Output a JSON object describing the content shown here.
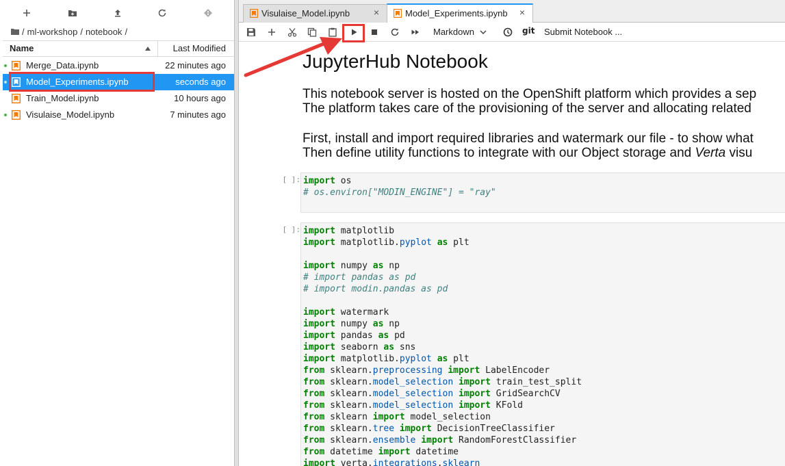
{
  "left_panel": {
    "toolbar": {
      "new_launcher": "new-launcher",
      "new_folder": "new-folder",
      "upload": "upload",
      "refresh": "refresh",
      "git_clone": "git-clone"
    },
    "breadcrumb": {
      "root_icon": "folder-icon",
      "separator": "/",
      "segments": [
        "ml-workshop",
        "notebook"
      ],
      "trailing": "/"
    },
    "file_list": {
      "headers": {
        "name": "Name",
        "modified": "Last Modified"
      },
      "files": [
        {
          "name": "Merge_Data.ipynb",
          "modified": "22 minutes ago",
          "running": true,
          "selected": false
        },
        {
          "name": "Model_Experiments.ipynb",
          "modified": "seconds ago",
          "running": true,
          "selected": true
        },
        {
          "name": "Train_Model.ipynb",
          "modified": "10 hours ago",
          "running": false,
          "selected": false
        },
        {
          "name": "Visulaise_Model.ipynb",
          "modified": "7 minutes ago",
          "running": true,
          "selected": false
        }
      ]
    }
  },
  "tabs": [
    {
      "label": "Visulaise_Model.ipynb",
      "active": false,
      "close": "×"
    },
    {
      "label": "Model_Experiments.ipynb",
      "active": true,
      "close": "×"
    }
  ],
  "notebook_toolbar": {
    "cell_type": "Markdown",
    "git_label": "git",
    "submit_label": "Submit Notebook ..."
  },
  "notebook": {
    "title": "JupyterHub Notebook",
    "para1_line1": "This notebook server is hosted on the OpenShift platform which provides a sep",
    "para1_line2": "The platform takes care of the provisioning of the server and allocating related",
    "para2_line1": "First, install and import required libraries and watermark our file - to show what",
    "para2_line2_prefix": "Then define utility functions to integrate with our Object storage and ",
    "para2_line2_em": "Verta",
    "para2_line2_suffix": " visu",
    "cells": [
      {
        "prompt": "[ ]:",
        "lines": [
          [
            [
              "kw",
              "import"
            ],
            [
              "t",
              " os"
            ]
          ],
          [
            [
              "cm",
              "# os.environ[\"MODIN_ENGINE\"] = \"ray\""
            ]
          ],
          [
            [
              "t",
              ""
            ]
          ]
        ]
      },
      {
        "prompt": "[ ]:",
        "lines": [
          [
            [
              "kw",
              "import"
            ],
            [
              "t",
              " matplotlib"
            ]
          ],
          [
            [
              "kw",
              "import"
            ],
            [
              "t",
              " matplotlib."
            ],
            [
              "attr",
              "pyplot"
            ],
            [
              "t",
              " "
            ],
            [
              "kw",
              "as"
            ],
            [
              "t",
              " plt"
            ]
          ],
          [
            [
              "t",
              ""
            ]
          ],
          [
            [
              "kw",
              "import"
            ],
            [
              "t",
              " numpy "
            ],
            [
              "kw",
              "as"
            ],
            [
              "t",
              " np"
            ]
          ],
          [
            [
              "cm",
              "# import pandas as pd"
            ]
          ],
          [
            [
              "cm",
              "# import modin.pandas as pd"
            ]
          ],
          [
            [
              "t",
              ""
            ]
          ],
          [
            [
              "kw",
              "import"
            ],
            [
              "t",
              " watermark"
            ]
          ],
          [
            [
              "kw",
              "import"
            ],
            [
              "t",
              " numpy "
            ],
            [
              "kw",
              "as"
            ],
            [
              "t",
              " np"
            ]
          ],
          [
            [
              "kw",
              "import"
            ],
            [
              "t",
              " pandas "
            ],
            [
              "kw",
              "as"
            ],
            [
              "t",
              " pd"
            ]
          ],
          [
            [
              "kw",
              "import"
            ],
            [
              "t",
              " seaborn "
            ],
            [
              "kw",
              "as"
            ],
            [
              "t",
              " sns"
            ]
          ],
          [
            [
              "kw",
              "import"
            ],
            [
              "t",
              " matplotlib."
            ],
            [
              "attr",
              "pyplot"
            ],
            [
              "t",
              " "
            ],
            [
              "kw",
              "as"
            ],
            [
              "t",
              " plt"
            ]
          ],
          [
            [
              "kw",
              "from"
            ],
            [
              "t",
              " sklearn."
            ],
            [
              "attr",
              "preprocessing"
            ],
            [
              "t",
              " "
            ],
            [
              "kw",
              "import"
            ],
            [
              "t",
              " LabelEncoder"
            ]
          ],
          [
            [
              "kw",
              "from"
            ],
            [
              "t",
              " sklearn."
            ],
            [
              "attr",
              "model_selection"
            ],
            [
              "t",
              " "
            ],
            [
              "kw",
              "import"
            ],
            [
              "t",
              " train_test_split"
            ]
          ],
          [
            [
              "kw",
              "from"
            ],
            [
              "t",
              " sklearn."
            ],
            [
              "attr",
              "model_selection"
            ],
            [
              "t",
              " "
            ],
            [
              "kw",
              "import"
            ],
            [
              "t",
              " GridSearchCV"
            ]
          ],
          [
            [
              "kw",
              "from"
            ],
            [
              "t",
              " sklearn."
            ],
            [
              "attr",
              "model_selection"
            ],
            [
              "t",
              " "
            ],
            [
              "kw",
              "import"
            ],
            [
              "t",
              " KFold"
            ]
          ],
          [
            [
              "kw",
              "from"
            ],
            [
              "t",
              " sklearn "
            ],
            [
              "kw",
              "import"
            ],
            [
              "t",
              " model_selection"
            ]
          ],
          [
            [
              "kw",
              "from"
            ],
            [
              "t",
              " sklearn."
            ],
            [
              "attr",
              "tree"
            ],
            [
              "t",
              " "
            ],
            [
              "kw",
              "import"
            ],
            [
              "t",
              " DecisionTreeClassifier"
            ]
          ],
          [
            [
              "kw",
              "from"
            ],
            [
              "t",
              " sklearn."
            ],
            [
              "attr",
              "ensemble"
            ],
            [
              "t",
              " "
            ],
            [
              "kw",
              "import"
            ],
            [
              "t",
              " RandomForestClassifier"
            ]
          ],
          [
            [
              "kw",
              "from"
            ],
            [
              "t",
              " datetime "
            ],
            [
              "kw",
              "import"
            ],
            [
              "t",
              " datetime"
            ]
          ],
          [
            [
              "kw",
              "import"
            ],
            [
              "t",
              " verta."
            ],
            [
              "attr",
              "integrations"
            ],
            [
              "t",
              "."
            ],
            [
              "attr",
              "sklearn"
            ]
          ]
        ]
      }
    ]
  },
  "colors": {
    "selection": "#2196f3",
    "highlight": "#e53935",
    "running_dot": "#4caf50",
    "notebook_icon": "#f57c00"
  }
}
